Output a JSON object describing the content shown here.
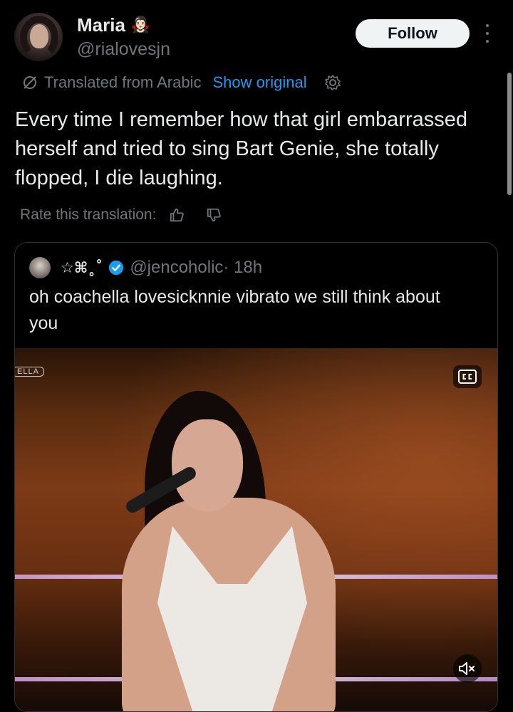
{
  "author": {
    "name": "Maria",
    "name_emoji": "🧛🏻‍♀️",
    "handle": "@rialovesjn",
    "follow_label": "Follow"
  },
  "translation": {
    "label": "Translated from Arabic",
    "show_original": "Show original",
    "rate_label": "Rate this translation:"
  },
  "tweet": {
    "text": "Every time I remember how that girl embarrassed herself and tried to sing Bart Genie, she totally flopped, I die laughing."
  },
  "quote": {
    "name": "☆⌘˳˚",
    "handle": "@jencoholic",
    "time": " · 18h",
    "text": "oh coachella lovesicknnie vibrato we still think about you",
    "video_overlay_text": "ELLA"
  },
  "colors": {
    "background": "#000000",
    "text": "#e7e9ea",
    "secondary": "#71767b",
    "link": "#1d9bf0",
    "verified": "#1d9bf0"
  },
  "icons": {
    "translate": "translate-icon",
    "settings": "gear-icon",
    "more": "more-icon",
    "thumbs_up": "thumbs-up-icon",
    "thumbs_down": "thumbs-down-icon",
    "verified": "verified-icon",
    "captions": "cc-icon",
    "mute": "muted-speaker-icon"
  }
}
